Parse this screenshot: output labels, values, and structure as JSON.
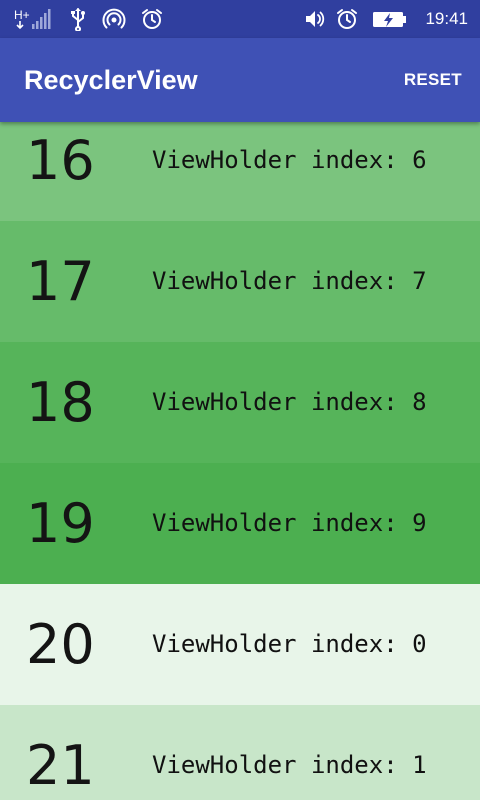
{
  "status_bar": {
    "time": "19:41",
    "network_label": "H+",
    "background": "#303F9F"
  },
  "app_bar": {
    "title": "RecyclerView",
    "reset_label": "RESET",
    "background": "#3F51B5"
  },
  "list": {
    "items": [
      {
        "number": "16",
        "label": "ViewHolder index: 6",
        "color": "#7BC47E"
      },
      {
        "number": "17",
        "label": "ViewHolder index: 7",
        "color": "#66BB6A"
      },
      {
        "number": "18",
        "label": "ViewHolder index: 8",
        "color": "#56B45A"
      },
      {
        "number": "19",
        "label": "ViewHolder index: 9",
        "color": "#4CAF50"
      },
      {
        "number": "20",
        "label": "ViewHolder index: 0",
        "color": "#E8F5E9"
      },
      {
        "number": "21",
        "label": "ViewHolder index: 1",
        "color": "#C8E6C9"
      }
    ]
  }
}
